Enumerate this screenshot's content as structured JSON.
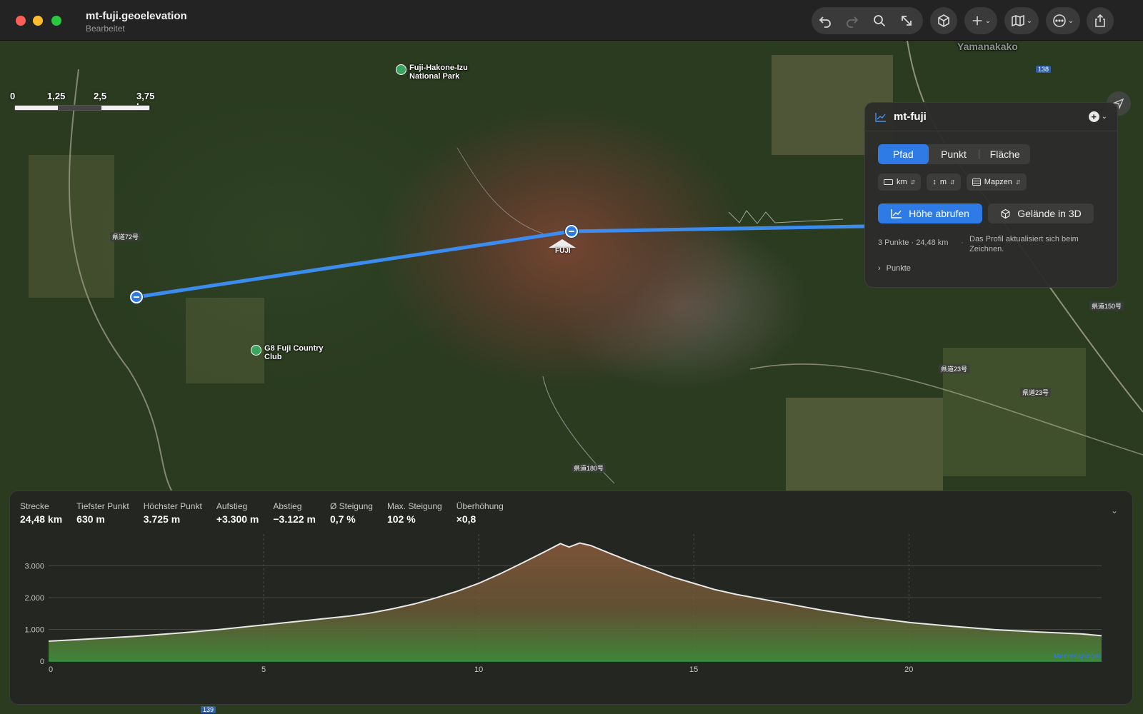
{
  "window": {
    "title": "mt-fuji.geoelevation",
    "subtitle": "Bearbeitet"
  },
  "toolbar": {
    "icons": [
      "undo-icon",
      "redo-icon",
      "search-icon",
      "resize-icon",
      "cube-icon",
      "plus-icon",
      "map-icon",
      "more-icon",
      "share-icon"
    ]
  },
  "map": {
    "scale_labels": [
      "0",
      "1,25",
      "2,5",
      "3,75 km"
    ],
    "labels": {
      "park": "Fuji-Hakone-Izu National Park",
      "club": "G8 Fuji Country Club",
      "fuji": "FUJI",
      "town": "Yamanakako"
    },
    "road_labels": [
      "138",
      "139",
      "県道150号",
      "県道23号",
      "県道23号",
      "県道180号",
      "県道72号"
    ]
  },
  "panel": {
    "title": "mt-fuji",
    "tabs": [
      "Pfad",
      "Punkt",
      "Fläche"
    ],
    "active_tab": "Pfad",
    "selects": {
      "distance": "km",
      "height": "m",
      "source": "Mapzen"
    },
    "primary_button": "Höhe abrufen",
    "secondary_button": "Gelände in 3D",
    "summary": "3 Punkte · 24,48 km",
    "hint": "Das Profil aktualisiert sich beim Zeichnen.",
    "points_label": "Punkte"
  },
  "stats": [
    {
      "label": "Strecke",
      "value": "24,48 km"
    },
    {
      "label": "Tiefster Punkt",
      "value": "630 m"
    },
    {
      "label": "Höchster Punkt",
      "value": "3.725 m"
    },
    {
      "label": "Aufstieg",
      "value": "+3.300 m"
    },
    {
      "label": "Abstieg",
      "value": "−3.122 m"
    },
    {
      "label": "Ø Steigung",
      "value": "0,7 %"
    },
    {
      "label": "Max. Steigung",
      "value": "102 %"
    },
    {
      "label": "Überhöhung",
      "value": "×0,8"
    }
  ],
  "colors": {
    "accent": "#2f7be6",
    "route": "#3c8cf0",
    "profile_line": "#e8e8e8"
  },
  "chart_data": {
    "type": "area",
    "title": "",
    "xlabel": "",
    "ylabel": "",
    "xlim": [
      0,
      24.48
    ],
    "ylim": [
      0,
      4000
    ],
    "x_ticks": [
      "0",
      "5",
      "10",
      "15",
      "20"
    ],
    "y_ticks": [
      "0",
      "1.000",
      "2.000",
      "3.000"
    ],
    "sea_level_label": "Meeresspiegel",
    "x": [
      0,
      1,
      2,
      3,
      4,
      5,
      6,
      7,
      7.5,
      8,
      8.5,
      9,
      9.5,
      10,
      10.5,
      11,
      11.5,
      11.9,
      12.1,
      12.35,
      12.6,
      13,
      13.5,
      14,
      14.5,
      15,
      15.5,
      16,
      17,
      18,
      19,
      20,
      21,
      22,
      23,
      24,
      24.48
    ],
    "y": [
      630,
      700,
      780,
      880,
      1000,
      1140,
      1280,
      1420,
      1520,
      1650,
      1800,
      1990,
      2200,
      2450,
      2750,
      3080,
      3420,
      3700,
      3590,
      3720,
      3640,
      3420,
      3150,
      2900,
      2650,
      2450,
      2250,
      2100,
      1850,
      1600,
      1390,
      1220,
      1100,
      990,
      920,
      860,
      800
    ]
  }
}
